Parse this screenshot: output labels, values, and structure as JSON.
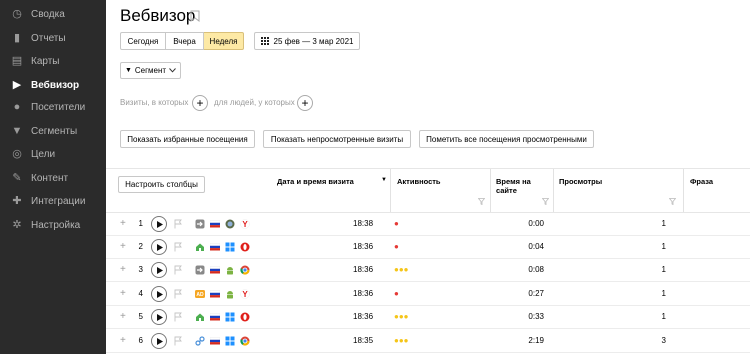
{
  "sidebar": {
    "items": [
      {
        "label": "Сводка",
        "icon": "dashboard-icon",
        "glyph": "◷",
        "active": false
      },
      {
        "label": "Отчеты",
        "icon": "bar-chart-icon",
        "glyph": "▮",
        "active": false
      },
      {
        "label": "Карты",
        "icon": "map-icon",
        "glyph": "▤",
        "active": false
      },
      {
        "label": "Вебвизор",
        "icon": "play-icon",
        "glyph": "▶",
        "active": true
      },
      {
        "label": "Посетители",
        "icon": "user-icon",
        "glyph": "●",
        "active": false
      },
      {
        "label": "Сегменты",
        "icon": "filter-icon",
        "glyph": "▼",
        "active": false
      },
      {
        "label": "Цели",
        "icon": "target-icon",
        "glyph": "◎",
        "active": false
      },
      {
        "label": "Контент",
        "icon": "pen-icon",
        "glyph": "✎",
        "active": false
      },
      {
        "label": "Интеграции",
        "icon": "puzzle-icon",
        "glyph": "✚",
        "active": false
      },
      {
        "label": "Настройка",
        "icon": "gear-icon",
        "glyph": "✲",
        "active": false
      }
    ]
  },
  "header": {
    "title": "Вебвизор",
    "period": {
      "options": [
        "Сегодня",
        "Вчера",
        "Неделя"
      ],
      "selected": "Неделя"
    },
    "date_range": "25 фев — 3 мар 2021",
    "segment_label": "Сегмент"
  },
  "filters": {
    "visits_text": "Визиты, в которых",
    "people_text": "для людей, у которых"
  },
  "actions": {
    "favorites": "Показать избранные посещения",
    "unviewed": "Показать непросмотренные визиты",
    "mark_viewed": "Пометить все посещения просмотренными"
  },
  "table": {
    "columns_button": "Настроить столбцы",
    "headers": {
      "datetime": "Дата и время визита",
      "activity": "Активность",
      "time_line1": "Время на",
      "time_line2": "сайте",
      "views": "Просмотры",
      "phrase": "Фраза"
    },
    "rows": [
      {
        "n": "1",
        "time": "18:38",
        "activity": 1,
        "duration": "0:00",
        "views": "1",
        "source": "arrow",
        "os": "mac",
        "browser": "yandex"
      },
      {
        "n": "2",
        "time": "18:36",
        "activity": 1,
        "duration": "0:04",
        "views": "1",
        "source": "home",
        "os": "windows",
        "browser": "opera"
      },
      {
        "n": "3",
        "time": "18:36",
        "activity": 3,
        "duration": "0:08",
        "views": "1",
        "source": "arrow",
        "os": "android",
        "browser": "chrome"
      },
      {
        "n": "4",
        "time": "18:36",
        "activity": 1,
        "duration": "0:27",
        "views": "1",
        "source": "ad",
        "os": "android",
        "browser": "yandex"
      },
      {
        "n": "5",
        "time": "18:36",
        "activity": 3,
        "duration": "0:33",
        "views": "1",
        "source": "home",
        "os": "windows",
        "browser": "opera"
      },
      {
        "n": "6",
        "time": "18:35",
        "activity": 3,
        "duration": "2:19",
        "views": "3",
        "source": "link",
        "os": "windows",
        "browser": "chrome"
      }
    ]
  },
  "colors": {
    "sidebar_bg": "#2b2b2b",
    "active_period": "#fde9a5",
    "activity_low": "#e53935",
    "activity_high": "#f5c518"
  }
}
